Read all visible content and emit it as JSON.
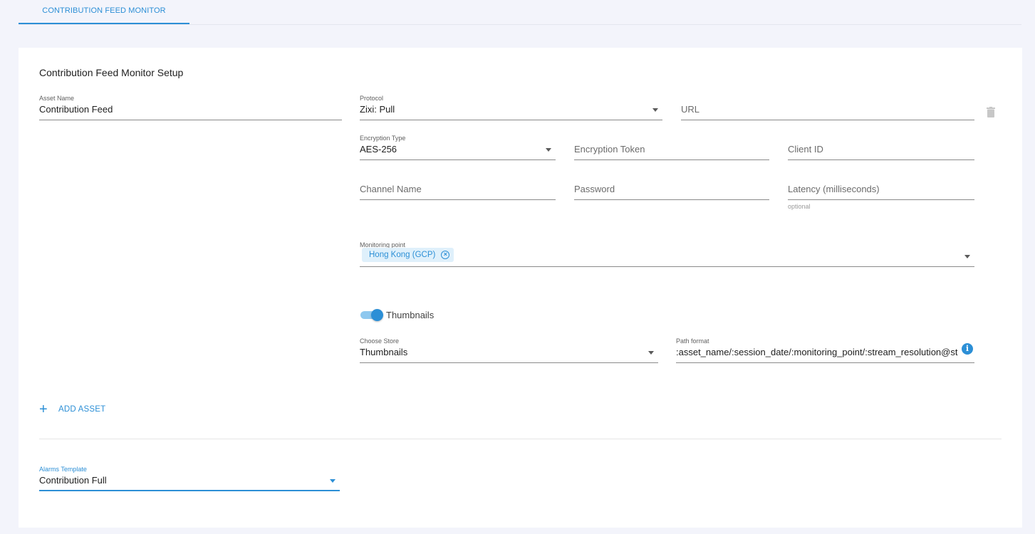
{
  "tab": {
    "label": "CONTRIBUTION FEED MONITOR"
  },
  "card": {
    "title": "Contribution Feed Monitor Setup"
  },
  "asset": {
    "name_label": "Asset Name",
    "name_value": "Contribution Feed",
    "protocol_label": "Protocol",
    "protocol_value": "Zixi: Pull",
    "url_placeholder": "URL",
    "encryption_type_label": "Encryption Type",
    "encryption_type_value": "AES-256",
    "encryption_token_placeholder": "Encryption Token",
    "client_id_placeholder": "Client ID",
    "channel_name_placeholder": "Channel Name",
    "password_placeholder": "Password",
    "latency_placeholder": "Latency (milliseconds)",
    "latency_helper": "optional",
    "monitoring_point_label": "Monitoring point",
    "monitoring_point_chip": "Hong Kong (GCP)",
    "thumbnails_toggle_label": "Thumbnails",
    "thumbnails_enabled": true,
    "store_label": "Choose Store",
    "store_value": "Thumbnails",
    "path_format_label": "Path format",
    "path_format_value": ":asset_name/:session_date/:monitoring_point/:stream_resolution@stre"
  },
  "actions": {
    "add_asset_label": "ADD ASSET"
  },
  "alarms": {
    "template_label": "Alarms Template",
    "template_value": "Contribution Full"
  },
  "icons": {
    "delete": "trash-icon",
    "chip_remove": "close-circle-icon",
    "info": "info-icon",
    "add": "plus-icon",
    "dropdown": "caret-down-icon"
  },
  "colors": {
    "accent": "#2c8fd6",
    "background": "#f3f4fb",
    "card": "#ffffff",
    "chip_bg": "#dff0fb"
  }
}
